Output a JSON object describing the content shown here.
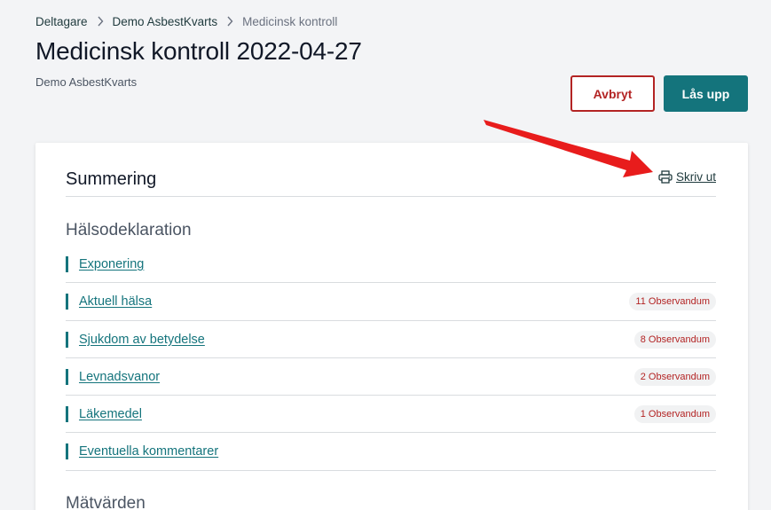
{
  "breadcrumb": {
    "items": [
      {
        "label": "Deltagare"
      },
      {
        "label": "Demo AsbestKvarts"
      }
    ],
    "current": "Medicinsk kontroll"
  },
  "header": {
    "title": "Medicinsk kontroll 2022-04-27",
    "subtitle": "Demo AsbestKvarts"
  },
  "actions": {
    "cancel_label": "Avbryt",
    "unlock_label": "Lås upp"
  },
  "summary": {
    "title": "Summering",
    "print_label": "Skriv ut",
    "section1_title": "Hälsodeklaration",
    "items": [
      {
        "label": "Exponering",
        "badge": ""
      },
      {
        "label": "Aktuell hälsa",
        "badge": "11 Observandum"
      },
      {
        "label": "Sjukdom av betydelse",
        "badge": "8 Observandum"
      },
      {
        "label": "Levnadsvanor",
        "badge": "2 Observandum"
      },
      {
        "label": "Läkemedel",
        "badge": "1 Observandum"
      },
      {
        "label": "Eventuella kommentarer",
        "badge": ""
      }
    ],
    "section2_title": "Mätvärden"
  },
  "colors": {
    "accent": "#14747c",
    "danger": "#b32424",
    "annotation_arrow": "#e81c1c"
  },
  "icons": {
    "breadcrumb_separator": "chevron-right-icon",
    "print": "printer-icon"
  }
}
